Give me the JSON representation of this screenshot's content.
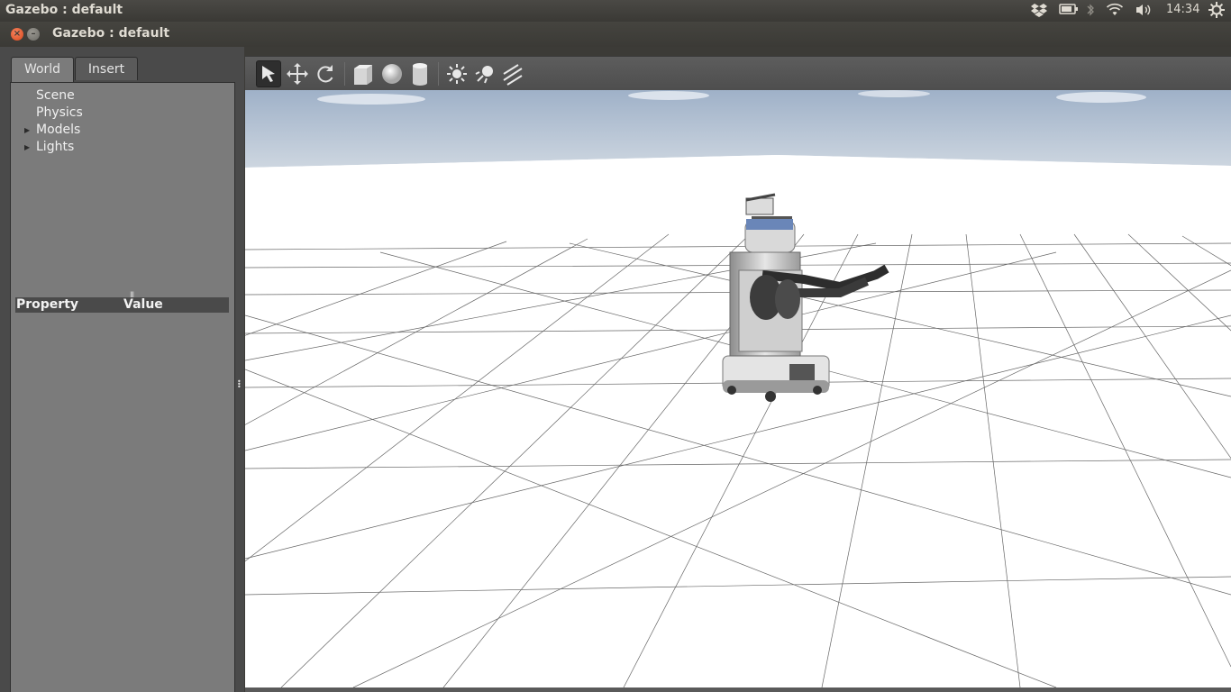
{
  "system_bar": {
    "app_title": "Gazebo : default",
    "clock": "14:34",
    "indicators": [
      "dropbox-icon",
      "battery-icon",
      "bluetooth-icon",
      "wifi-icon",
      "volume-icon",
      "settings-icon"
    ]
  },
  "window": {
    "title": "Gazebo : default"
  },
  "left_panel": {
    "tabs": [
      {
        "label": "World",
        "active": true
      },
      {
        "label": "Insert",
        "active": false
      }
    ],
    "tree": [
      {
        "label": "Scene",
        "expandable": false
      },
      {
        "label": "Physics",
        "expandable": false
      },
      {
        "label": "Models",
        "expandable": true
      },
      {
        "label": "Lights",
        "expandable": true
      }
    ],
    "property_table": {
      "columns": [
        "Property",
        "Value"
      ]
    }
  },
  "toolbar": {
    "tools": [
      {
        "name": "select-mode",
        "icon": "arrow-icon",
        "active": true
      },
      {
        "name": "translate-mode",
        "icon": "move-icon",
        "active": false
      },
      {
        "name": "rotate-mode",
        "icon": "rotate-icon",
        "active": false
      },
      {
        "name": "box-shape",
        "icon": "box-icon",
        "active": false
      },
      {
        "name": "sphere-shape",
        "icon": "sphere-icon",
        "active": false
      },
      {
        "name": "cylinder-shape",
        "icon": "cylinder-icon",
        "active": false
      },
      {
        "name": "point-light",
        "icon": "sun-icon",
        "active": false
      },
      {
        "name": "spot-light",
        "icon": "spotlight-icon",
        "active": false
      },
      {
        "name": "directional-light",
        "icon": "directional-light-icon",
        "active": false
      }
    ]
  },
  "colors": {
    "sky": "#b9c6d6",
    "ground": "#ffffff",
    "grid_line": "#555555",
    "panel_bg": "#7b7b7b",
    "close_button": "#e2562b"
  }
}
